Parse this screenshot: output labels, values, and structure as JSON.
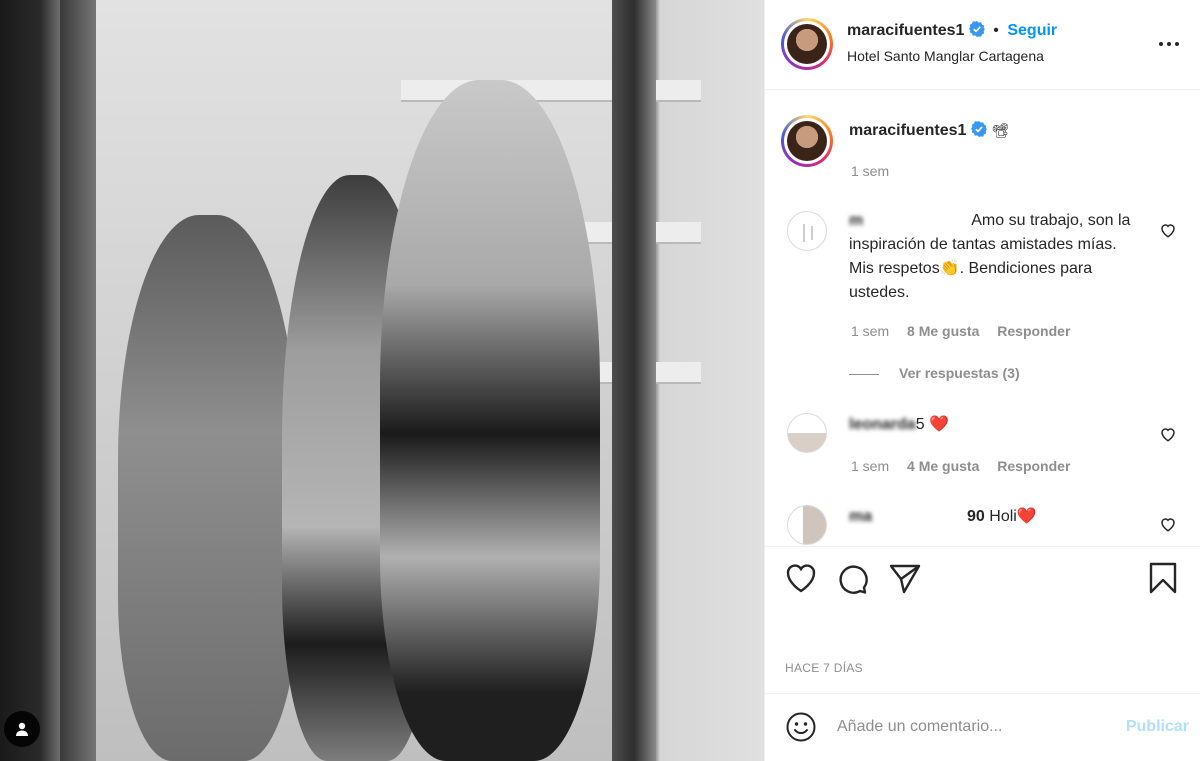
{
  "post": {
    "author": "maracifuentes1",
    "follow_label": "Seguir",
    "separator": "•",
    "location": "Hotel Santo Manglar Cartagena",
    "caption_emoji": "📽",
    "caption_time": "1 sem",
    "date": "HACE 7 DÍAS"
  },
  "comments": [
    {
      "user": "m",
      "text": "Amo su trabajo, son la inspiración de tantas amistades mías. Mis respetos👏. Bendiciones para ustedes.",
      "time": "1 sem",
      "likes": "8 Me gusta",
      "reply": "Responder",
      "view_replies": "Ver respuestas (3)"
    },
    {
      "user": "leonarda",
      "user_suffix": "5",
      "text": "❤️",
      "time": "1 sem",
      "likes": "4 Me gusta",
      "reply": "Responder"
    },
    {
      "user": "ma",
      "user_suffix": "90",
      "text": "Holi❤️"
    }
  ],
  "composer": {
    "placeholder": "Añade un comentario...",
    "publish_label": "Publicar"
  },
  "colors": {
    "accent": "#0095f6",
    "verified": "#3897f0",
    "muted": "#8e8e8e",
    "publish_disabled": "#b2dffc",
    "heart": "#ed4956"
  }
}
